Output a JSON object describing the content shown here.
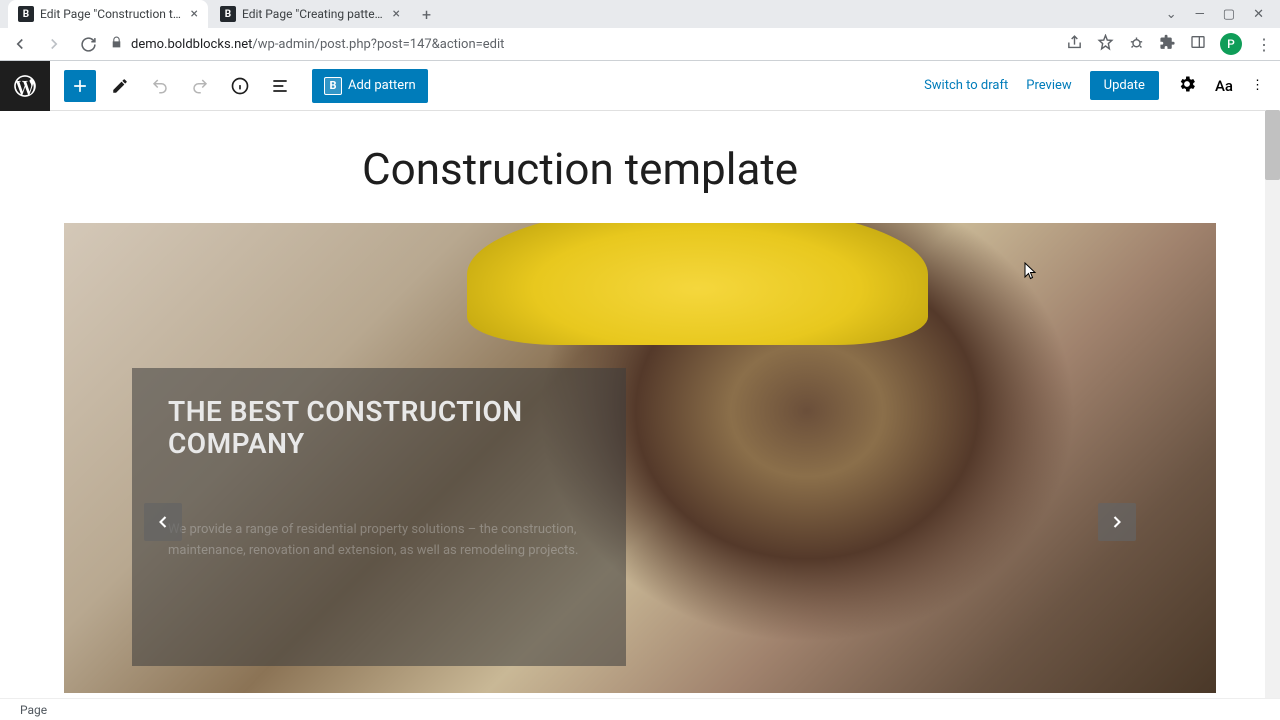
{
  "browser": {
    "tabs": [
      {
        "title": "Edit Page \"Construction template\"",
        "active": true
      },
      {
        "title": "Edit Page \"Creating patterns dire",
        "active": false
      }
    ],
    "url_host": "demo.boldblocks.net",
    "url_path": "/wp-admin/post.php?post=147&action=edit",
    "profile_initial": "P"
  },
  "wp": {
    "add_pattern": "Add pattern",
    "switch_draft": "Switch to draft",
    "preview": "Preview",
    "update": "Update"
  },
  "page": {
    "title": "Construction template",
    "hero_heading": "THE BEST CONSTRUCTION COMPANY",
    "hero_body": "We provide a range of residential property solutions – the construction, maintenance, renovation and extension, as well as remodeling projects."
  },
  "status": "Page"
}
